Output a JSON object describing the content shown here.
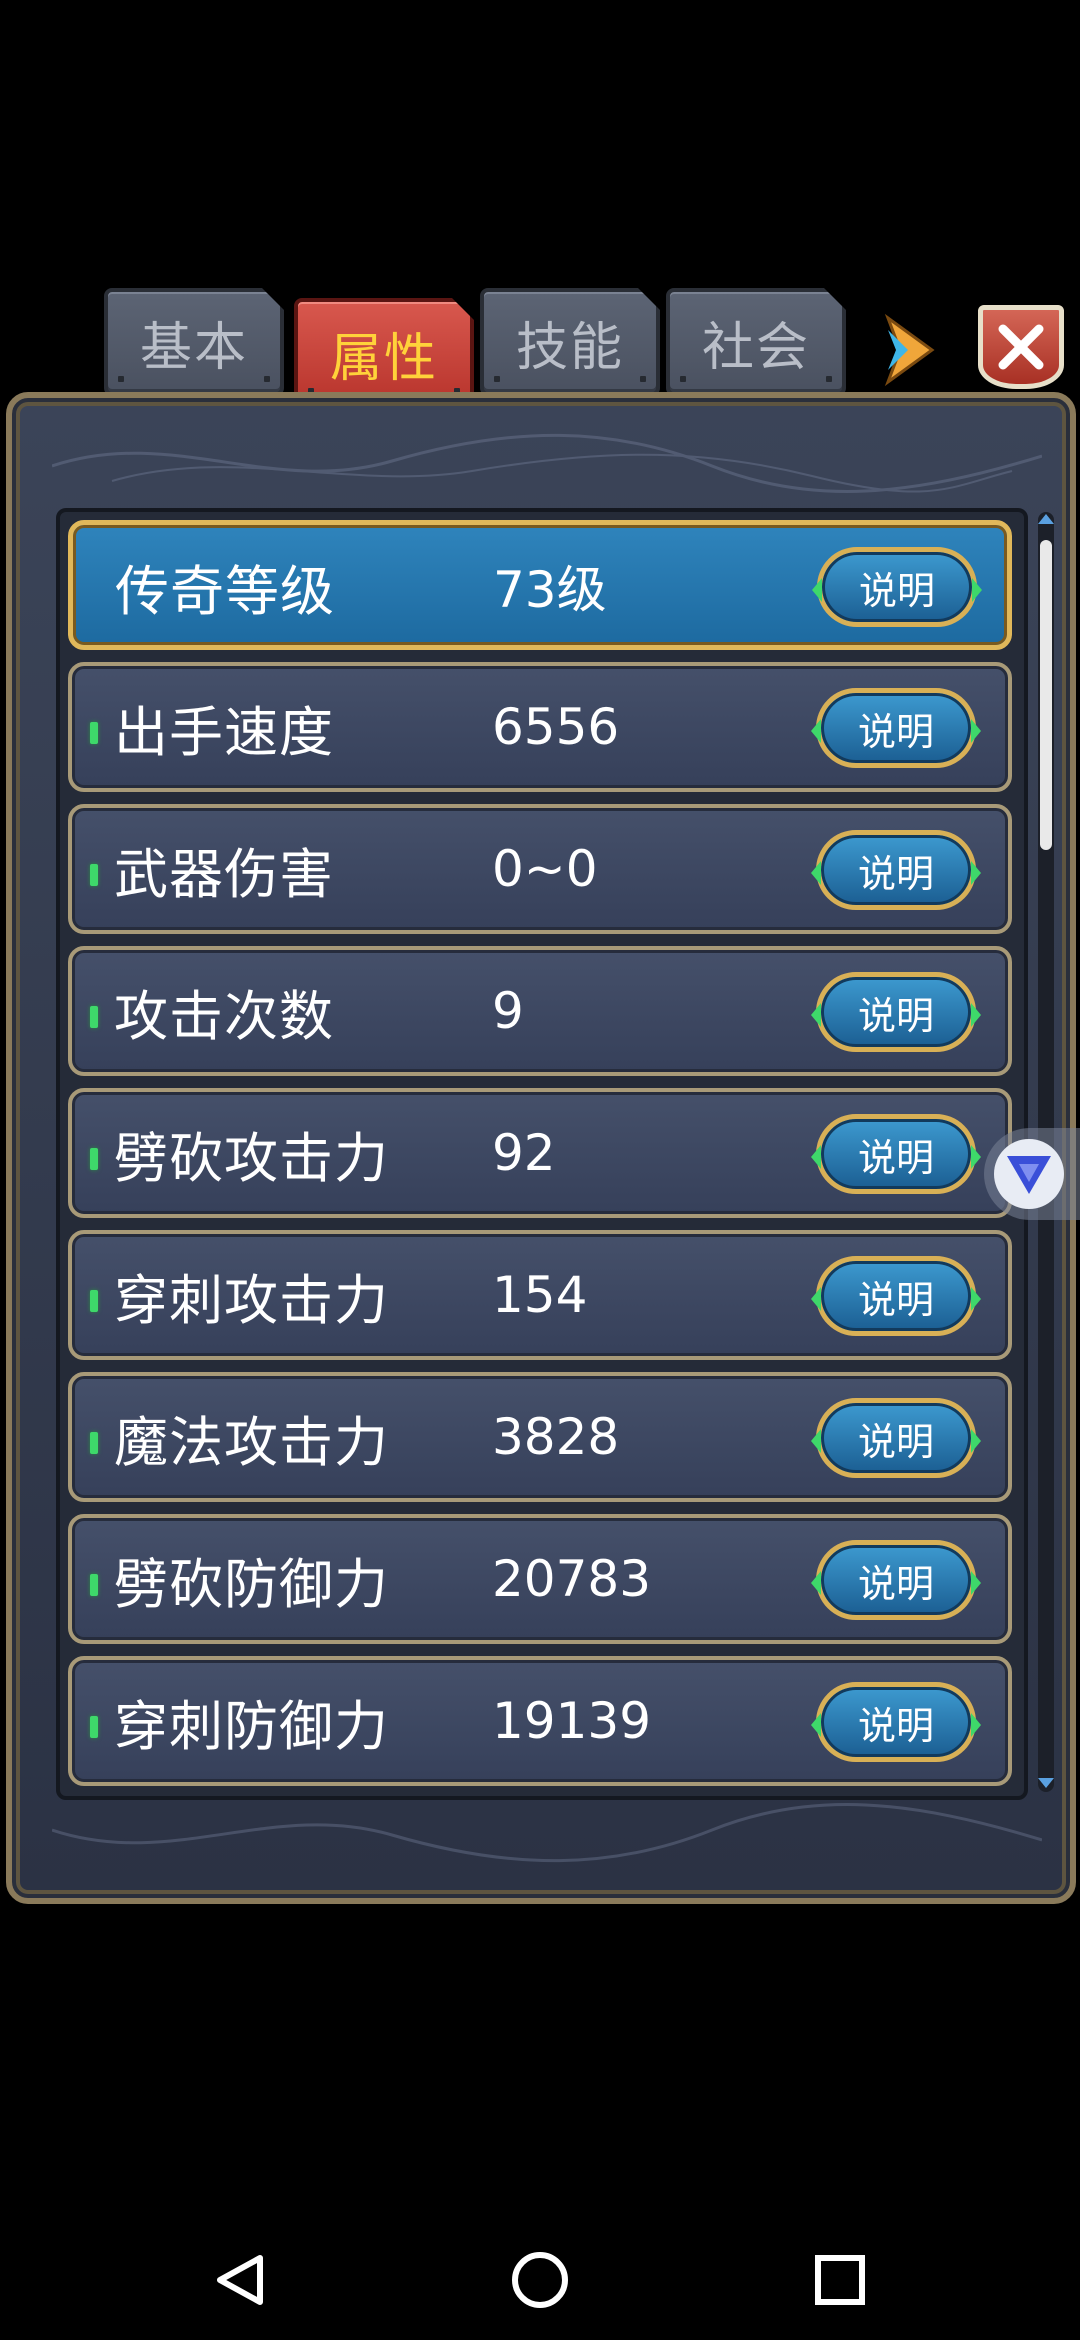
{
  "tabs": [
    {
      "label": "基本"
    },
    {
      "label": "属性"
    },
    {
      "label": "技能"
    },
    {
      "label": "社会"
    }
  ],
  "active_tab": "属性",
  "attributes": [
    {
      "label": "传奇等级",
      "value": "73级",
      "button": "说明"
    },
    {
      "label": "出手速度",
      "value": "6556",
      "button": "说明"
    },
    {
      "label": "武器伤害",
      "value": "0~0",
      "button": "说明"
    },
    {
      "label": "攻击次数",
      "value": "9",
      "button": "说明"
    },
    {
      "label": "劈砍攻击力",
      "value": "92",
      "button": "说明"
    },
    {
      "label": "穿刺攻击力",
      "value": "154",
      "button": "说明"
    },
    {
      "label": "魔法攻击力",
      "value": "3828",
      "button": "说明"
    },
    {
      "label": "劈砍防御力",
      "value": "20783",
      "button": "说明"
    },
    {
      "label": "穿刺防御力",
      "value": "19139",
      "button": "说明"
    }
  ],
  "colors": {
    "panel_bg": "#2b3244",
    "row_bg": "#3d4862",
    "highlight_row": "#2a7bb3",
    "gold_border": "#e1b85a",
    "active_tab": "#c9433a",
    "active_tab_text": "#ffd23a",
    "marker_green": "#3ed86a"
  },
  "icons": {
    "next_arrow": "arrow-right-icon",
    "close": "close-icon",
    "float": "v-badge-icon",
    "nav_back": "back-triangle-icon",
    "nav_home": "home-circle-icon",
    "nav_recents": "recents-square-icon"
  }
}
